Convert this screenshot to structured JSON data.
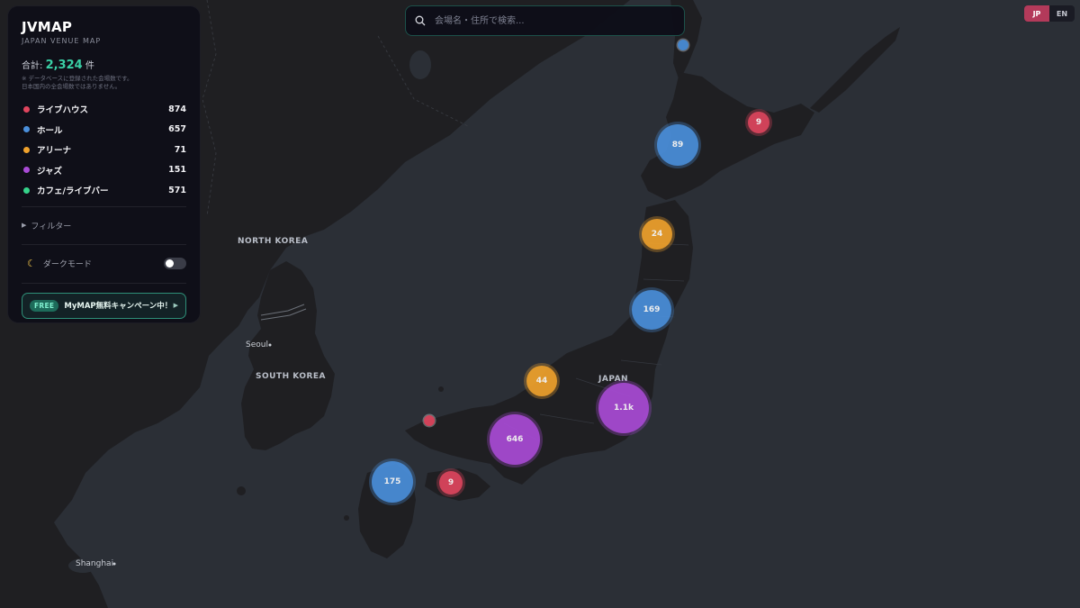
{
  "app": {
    "title": "JVMAP",
    "subtitle": "JAPAN VENUE MAP"
  },
  "summary": {
    "total_label": "合計:",
    "total_value": "2,324",
    "total_unit": "件",
    "note_line1": "※ データベースに登録された会場数です。",
    "note_line2": "日本国内の全会場数ではありません。"
  },
  "categories": [
    {
      "label": "ライブハウス",
      "count": "874",
      "color": "#e0455e"
    },
    {
      "label": "ホール",
      "count": "657",
      "color": "#4a8fdb"
    },
    {
      "label": "アリーナ",
      "count": "71",
      "color": "#f0a22c"
    },
    {
      "label": "ジャズ",
      "count": "151",
      "color": "#a94bd6"
    },
    {
      "label": "カフェ/ライブバー",
      "count": "571",
      "color": "#35d38a"
    }
  ],
  "filter": {
    "label": "フィルター",
    "icon": "triangle-right-icon"
  },
  "dark_mode": {
    "label": "ダークモード",
    "icon": "moon-icon",
    "enabled": false
  },
  "promo": {
    "badge": "FREE",
    "text": "MyMAP無料キャンペーン中！"
  },
  "search": {
    "placeholder": "会場名・住所で検索...",
    "icon": "search-icon"
  },
  "language": {
    "options": [
      "JP",
      "EN"
    ],
    "selected": "JP"
  },
  "map_labels": {
    "north_korea": "NORTH KOREA",
    "south_korea": "SOUTH KOREA",
    "japan": "JAPAN",
    "seoul": "Seoul",
    "shanghai": "Shanghai"
  },
  "clusters": [
    {
      "label": "9",
      "type": "ライブハウス",
      "color": "#e0455e"
    },
    {
      "label": "89",
      "type": "ホール",
      "color": "#4a8fdb"
    },
    {
      "label": "24",
      "type": "アリーナ",
      "color": "#f0a22c"
    },
    {
      "label": "169",
      "type": "ホール",
      "color": "#4a8fdb"
    },
    {
      "label": "44",
      "type": "アリーナ",
      "color": "#f0a22c"
    },
    {
      "label": "1.1k",
      "type": "ジャズ",
      "color": "#a94bd6"
    },
    {
      "label": "646",
      "type": "ジャズ",
      "color": "#a94bd6"
    },
    {
      "label": "175",
      "type": "ホール",
      "color": "#4a8fdb"
    },
    {
      "label": "9",
      "type": "ライブハウス",
      "color": "#e0455e"
    },
    {
      "label": "",
      "type": "ホール",
      "color": "#4a8fdb"
    },
    {
      "label": "",
      "type": "ライブハウス",
      "color": "#e0455e"
    }
  ]
}
